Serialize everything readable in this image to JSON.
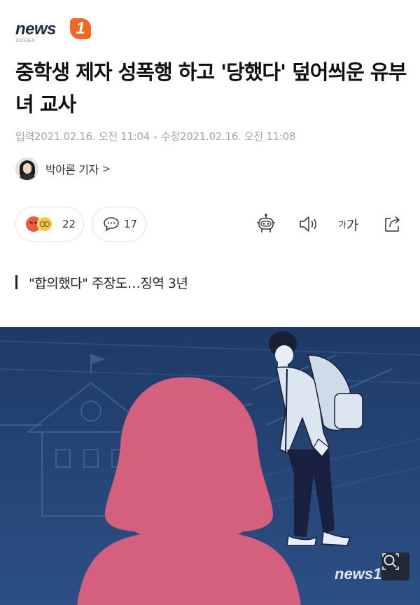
{
  "logo": {
    "word": "news",
    "badge": "1",
    "sub": "KOREA"
  },
  "article": {
    "title": "중학생 제자 성폭행 하고 '당했다' 덮어씌운 유부녀 교사",
    "meta": {
      "input_label": "입력",
      "input_date": "2021.02.16. 오전 11:04",
      "edit_label": "수정",
      "edit_date": "2021.02.16. 오전 11:08"
    },
    "author": {
      "name": "박아론 기자",
      "chevron": ">"
    },
    "subhead": "\"합의했다\" 주장도…징역 3년"
  },
  "actions": {
    "reaction_count": "22",
    "comment_count": "17",
    "font_small": "가",
    "font_large": "가"
  },
  "image": {
    "watermark": "news1"
  },
  "colors": {
    "brand_orange": "#f26522",
    "brand_navy": "#1f2a44",
    "photo_bg": "#23406d",
    "silhouette": "#d5607e",
    "meta_gray": "#a5a5a5"
  },
  "icons": [
    "angry-emoji-icon",
    "sad-emoji-icon",
    "comment-bubble-icon",
    "robot-icon",
    "speaker-icon",
    "share-icon",
    "zoom-icon"
  ]
}
